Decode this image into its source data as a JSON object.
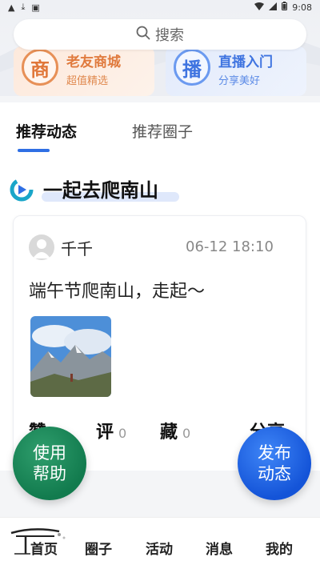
{
  "status_bar": {
    "time": "9:08"
  },
  "search": {
    "label": "搜索"
  },
  "entries": [
    {
      "icon_char": "商",
      "title": "老友商城",
      "subtitle": "超值精选"
    },
    {
      "icon_char": "播",
      "title": "直播入门",
      "subtitle": "分享美好"
    }
  ],
  "tabs": {
    "active": "推荐动态",
    "inactive": "推荐圈子"
  },
  "topic": {
    "title": "一起去爬南山"
  },
  "post": {
    "user": "千千",
    "time": "06-12 18:10",
    "text": "端午节爬南山，走起～",
    "actions": [
      {
        "label": "赞",
        "count": "0"
      },
      {
        "label": "评",
        "count": "0"
      },
      {
        "label": "藏",
        "count": "0"
      },
      {
        "label": "分享",
        "count": ""
      }
    ]
  },
  "fabs": {
    "help": "使用帮助",
    "publish": "发布动态"
  },
  "nav": {
    "home": "首页",
    "circle": "圈子",
    "activity": "活动",
    "messages": "消息",
    "mine": "我的"
  },
  "colors": {
    "accent": "#2f6fe4",
    "help_green": "#127b4e",
    "publish_blue": "#1454d8"
  }
}
